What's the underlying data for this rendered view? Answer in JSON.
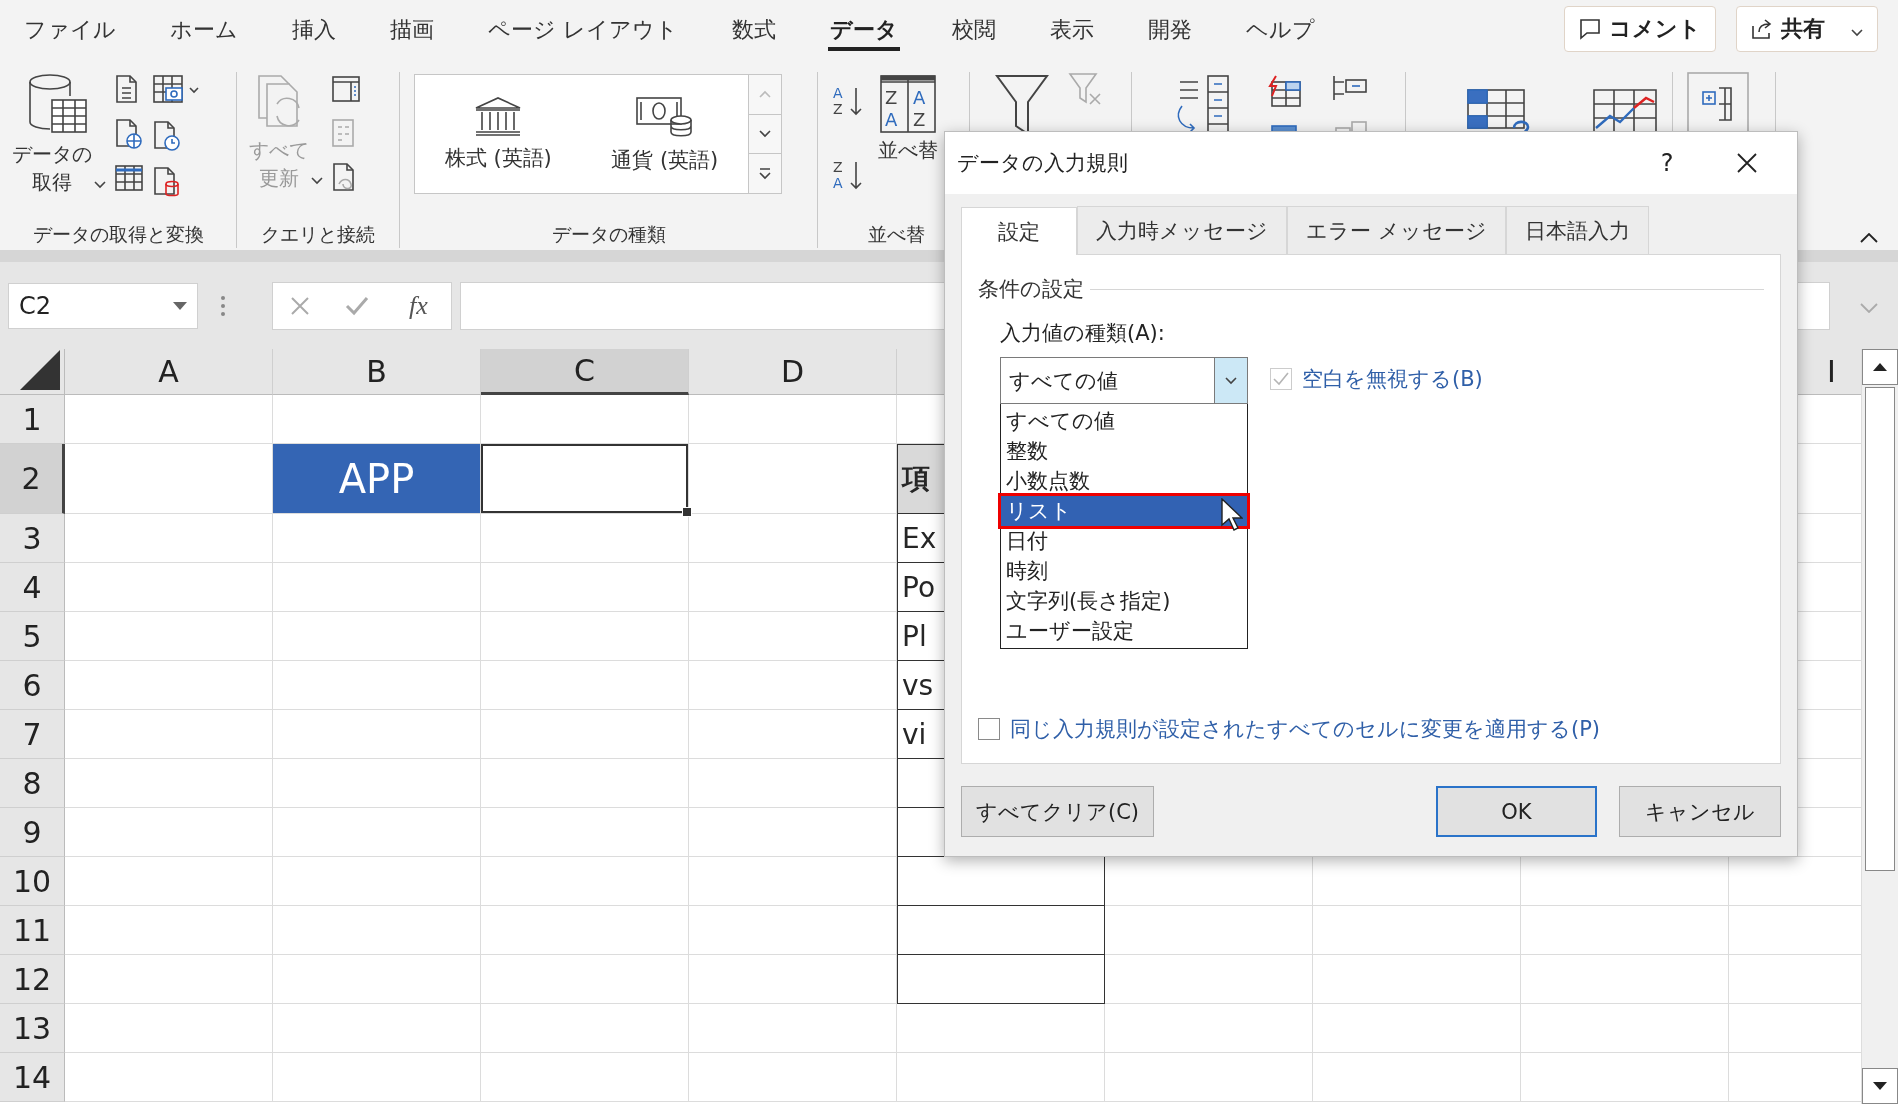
{
  "menu_tabs": [
    {
      "label": "ファイル",
      "selected": false
    },
    {
      "label": "ホーム",
      "selected": false
    },
    {
      "label": "挿入",
      "selected": false
    },
    {
      "label": "描画",
      "selected": false
    },
    {
      "label": "ページ レイアウト",
      "selected": false
    },
    {
      "label": "数式",
      "selected": false
    },
    {
      "label": "データ",
      "selected": true
    },
    {
      "label": "校閲",
      "selected": false
    },
    {
      "label": "表示",
      "selected": false
    },
    {
      "label": "開発",
      "selected": false
    },
    {
      "label": "ヘルプ",
      "selected": false
    }
  ],
  "comment_button": {
    "label": "コメント"
  },
  "share_button": {
    "label": "共有"
  },
  "ribbon": {
    "get_data": {
      "button": "データの取得",
      "group_label": "データの取得と変換"
    },
    "queries": {
      "button": "すべて更新",
      "disabled": true,
      "group_label": "クエリと接続"
    },
    "data_types": {
      "items": [
        "株式 (英語)",
        "通貨 (英語)"
      ],
      "group_label": "データの種類"
    },
    "sort": {
      "button": "並べ替",
      "group_label": "並べ替",
      "ascending_icon": [
        "A",
        "Z"
      ],
      "descending_icon": [
        "Z",
        "A"
      ],
      "table_icon": [
        "Z",
        "A",
        "A",
        "Z"
      ]
    }
  },
  "formula_bar": {
    "name_box": "C2",
    "function_label": "fx"
  },
  "sheet": {
    "columns": [
      {
        "label": "A",
        "selected": false
      },
      {
        "label": "B",
        "selected": false
      },
      {
        "label": "C",
        "selected": true
      },
      {
        "label": "D",
        "selected": false
      }
    ],
    "far_column": {
      "label": "I",
      "selected": false
    },
    "rows": [
      {
        "number": "1",
        "selected": false,
        "bordered": false
      },
      {
        "number": "2",
        "selected": true,
        "bordered": true,
        "column_b": "APP",
        "column_e": {
          "text": "項",
          "kind": "header"
        }
      },
      {
        "number": "3",
        "selected": false,
        "bordered": true,
        "column_e": {
          "text": "Ex",
          "kind": "item"
        }
      },
      {
        "number": "4",
        "selected": false,
        "bordered": true,
        "column_e": {
          "text": "Po",
          "kind": "item"
        }
      },
      {
        "number": "5",
        "selected": false,
        "bordered": true,
        "column_e": {
          "text": "Pl",
          "kind": "item"
        }
      },
      {
        "number": "6",
        "selected": false,
        "bordered": true,
        "column_e": {
          "text": "vs",
          "kind": "item"
        }
      },
      {
        "number": "7",
        "selected": false,
        "bordered": true,
        "column_e": {
          "text": "vi",
          "kind": "item"
        }
      },
      {
        "number": "8",
        "selected": false,
        "bordered": true
      },
      {
        "number": "9",
        "selected": false,
        "bordered": true
      },
      {
        "number": "10",
        "selected": false,
        "bordered": true
      },
      {
        "number": "11",
        "selected": false,
        "bordered": true
      },
      {
        "number": "12",
        "selected": false,
        "bordered": true
      },
      {
        "number": "13",
        "selected": false,
        "bordered": false
      },
      {
        "number": "14",
        "selected": false,
        "bordered": false
      }
    ]
  },
  "dialog": {
    "title": "データの入力規則",
    "help": "?",
    "tabs": [
      {
        "label": "設定",
        "selected": true
      },
      {
        "label": "入力時メッセージ",
        "selected": false
      },
      {
        "label": "エラー メッセージ",
        "selected": false
      },
      {
        "label": "日本語入力",
        "selected": false
      }
    ],
    "section_title": "条件の設定",
    "type_label": "入力値の種類(A):",
    "type_value": "すべての値",
    "options": [
      {
        "label": "すべての値",
        "selected": false,
        "highlighted": false
      },
      {
        "label": "整数",
        "selected": false,
        "highlighted": false
      },
      {
        "label": "小数点数",
        "selected": false,
        "highlighted": false
      },
      {
        "label": "リスト",
        "selected": true,
        "highlighted": true
      },
      {
        "label": "日付",
        "selected": false,
        "highlighted": false
      },
      {
        "label": "時刻",
        "selected": false,
        "highlighted": false
      },
      {
        "label": "文字列(長さ指定)",
        "selected": false,
        "highlighted": false
      },
      {
        "label": "ユーザー設定",
        "selected": false,
        "highlighted": false
      }
    ],
    "ignore_blank": {
      "label": "空白を無視する(B)",
      "checked": true,
      "disabled": true
    },
    "apply_all": {
      "label": "同じ入力規則が設定されたすべてのセルに変更を適用する(P)",
      "checked": false,
      "disabled": false
    },
    "buttons": [
      {
        "label": "すべてクリア(C)",
        "kind": "normal"
      },
      {
        "label": "OK",
        "kind": "default"
      },
      {
        "label": "キャンセル",
        "kind": "normal"
      }
    ]
  }
}
